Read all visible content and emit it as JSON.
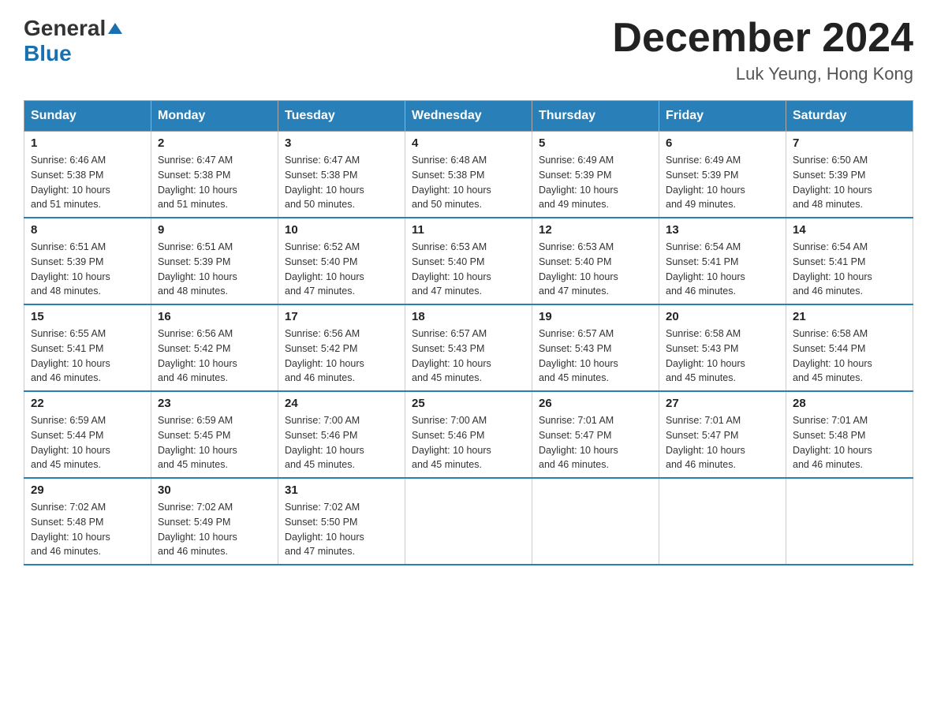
{
  "header": {
    "logo_general": "General",
    "logo_blue": "Blue",
    "month_title": "December 2024",
    "location": "Luk Yeung, Hong Kong"
  },
  "days_of_week": [
    "Sunday",
    "Monday",
    "Tuesday",
    "Wednesday",
    "Thursday",
    "Friday",
    "Saturday"
  ],
  "weeks": [
    [
      {
        "day": "1",
        "sunrise": "6:46 AM",
        "sunset": "5:38 PM",
        "daylight": "10 hours and 51 minutes."
      },
      {
        "day": "2",
        "sunrise": "6:47 AM",
        "sunset": "5:38 PM",
        "daylight": "10 hours and 51 minutes."
      },
      {
        "day": "3",
        "sunrise": "6:47 AM",
        "sunset": "5:38 PM",
        "daylight": "10 hours and 50 minutes."
      },
      {
        "day": "4",
        "sunrise": "6:48 AM",
        "sunset": "5:38 PM",
        "daylight": "10 hours and 50 minutes."
      },
      {
        "day": "5",
        "sunrise": "6:49 AM",
        "sunset": "5:39 PM",
        "daylight": "10 hours and 49 minutes."
      },
      {
        "day": "6",
        "sunrise": "6:49 AM",
        "sunset": "5:39 PM",
        "daylight": "10 hours and 49 minutes."
      },
      {
        "day": "7",
        "sunrise": "6:50 AM",
        "sunset": "5:39 PM",
        "daylight": "10 hours and 48 minutes."
      }
    ],
    [
      {
        "day": "8",
        "sunrise": "6:51 AM",
        "sunset": "5:39 PM",
        "daylight": "10 hours and 48 minutes."
      },
      {
        "day": "9",
        "sunrise": "6:51 AM",
        "sunset": "5:39 PM",
        "daylight": "10 hours and 48 minutes."
      },
      {
        "day": "10",
        "sunrise": "6:52 AM",
        "sunset": "5:40 PM",
        "daylight": "10 hours and 47 minutes."
      },
      {
        "day": "11",
        "sunrise": "6:53 AM",
        "sunset": "5:40 PM",
        "daylight": "10 hours and 47 minutes."
      },
      {
        "day": "12",
        "sunrise": "6:53 AM",
        "sunset": "5:40 PM",
        "daylight": "10 hours and 47 minutes."
      },
      {
        "day": "13",
        "sunrise": "6:54 AM",
        "sunset": "5:41 PM",
        "daylight": "10 hours and 46 minutes."
      },
      {
        "day": "14",
        "sunrise": "6:54 AM",
        "sunset": "5:41 PM",
        "daylight": "10 hours and 46 minutes."
      }
    ],
    [
      {
        "day": "15",
        "sunrise": "6:55 AM",
        "sunset": "5:41 PM",
        "daylight": "10 hours and 46 minutes."
      },
      {
        "day": "16",
        "sunrise": "6:56 AM",
        "sunset": "5:42 PM",
        "daylight": "10 hours and 46 minutes."
      },
      {
        "day": "17",
        "sunrise": "6:56 AM",
        "sunset": "5:42 PM",
        "daylight": "10 hours and 46 minutes."
      },
      {
        "day": "18",
        "sunrise": "6:57 AM",
        "sunset": "5:43 PM",
        "daylight": "10 hours and 45 minutes."
      },
      {
        "day": "19",
        "sunrise": "6:57 AM",
        "sunset": "5:43 PM",
        "daylight": "10 hours and 45 minutes."
      },
      {
        "day": "20",
        "sunrise": "6:58 AM",
        "sunset": "5:43 PM",
        "daylight": "10 hours and 45 minutes."
      },
      {
        "day": "21",
        "sunrise": "6:58 AM",
        "sunset": "5:44 PM",
        "daylight": "10 hours and 45 minutes."
      }
    ],
    [
      {
        "day": "22",
        "sunrise": "6:59 AM",
        "sunset": "5:44 PM",
        "daylight": "10 hours and 45 minutes."
      },
      {
        "day": "23",
        "sunrise": "6:59 AM",
        "sunset": "5:45 PM",
        "daylight": "10 hours and 45 minutes."
      },
      {
        "day": "24",
        "sunrise": "7:00 AM",
        "sunset": "5:46 PM",
        "daylight": "10 hours and 45 minutes."
      },
      {
        "day": "25",
        "sunrise": "7:00 AM",
        "sunset": "5:46 PM",
        "daylight": "10 hours and 45 minutes."
      },
      {
        "day": "26",
        "sunrise": "7:01 AM",
        "sunset": "5:47 PM",
        "daylight": "10 hours and 46 minutes."
      },
      {
        "day": "27",
        "sunrise": "7:01 AM",
        "sunset": "5:47 PM",
        "daylight": "10 hours and 46 minutes."
      },
      {
        "day": "28",
        "sunrise": "7:01 AM",
        "sunset": "5:48 PM",
        "daylight": "10 hours and 46 minutes."
      }
    ],
    [
      {
        "day": "29",
        "sunrise": "7:02 AM",
        "sunset": "5:48 PM",
        "daylight": "10 hours and 46 minutes."
      },
      {
        "day": "30",
        "sunrise": "7:02 AM",
        "sunset": "5:49 PM",
        "daylight": "10 hours and 46 minutes."
      },
      {
        "day": "31",
        "sunrise": "7:02 AM",
        "sunset": "5:50 PM",
        "daylight": "10 hours and 47 minutes."
      },
      null,
      null,
      null,
      null
    ]
  ],
  "labels": {
    "sunrise": "Sunrise:",
    "sunset": "Sunset:",
    "daylight": "Daylight:"
  }
}
